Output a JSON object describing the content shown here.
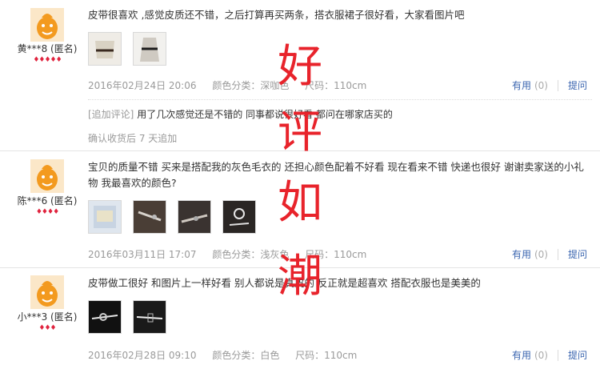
{
  "reviews": [
    {
      "username": "黄***8 (匿名)",
      "content": "皮带很喜欢 ,感觉皮质还不错，之后打算再买两条，搭衣服裙子很好看，大家看图片吧",
      "date": "2016年02月24日 20:06",
      "color_label": "颜色分类：深咖色",
      "size_label": "尺码：110cm",
      "useful_label": "有用",
      "useful_count": "(0)",
      "ask_label": "提问",
      "append_tag": "[追加评论]",
      "append_text": "用了几次感觉还是不错的 同事都说很好看 都问在哪家店买的",
      "append_note": "确认收货后 7 天追加"
    },
    {
      "username": "陈***6 (匿名)",
      "content": "宝贝的质量不错 买来是搭配我的灰色毛衣的 还担心颜色配着不好看 现在看来不错 快递也很好 谢谢卖家送的小礼物 我最喜欢的颜色?",
      "date": "2016年03月11日 17:07",
      "color_label": "颜色分类：浅灰色",
      "size_label": "尺码：110cm",
      "useful_label": "有用",
      "useful_count": "(0)",
      "ask_label": "提问"
    },
    {
      "username": "小***3 (匿名)",
      "content": "皮带做工很好 和图片上一样好看 别人都说是真皮的 反正就是超喜欢 搭配衣服也是美美的",
      "date": "2016年02月28日 09:10",
      "color_label": "颜色分类：白色",
      "size_label": "尺码：110cm",
      "useful_label": "有用",
      "useful_count": "(0)",
      "ask_label": "提问"
    }
  ],
  "rating_gems": "♦♦♦♦♦",
  "rating_gems_short": "♦♦♦♦",
  "rating_gems_three": "♦♦♦",
  "overlay_chars": [
    "好",
    "评",
    "如",
    "潮"
  ],
  "colors": {
    "link": "#3b66b0",
    "overlay": "#e8232b",
    "gem": "#e0233e",
    "avatar": "#f39a1f"
  }
}
